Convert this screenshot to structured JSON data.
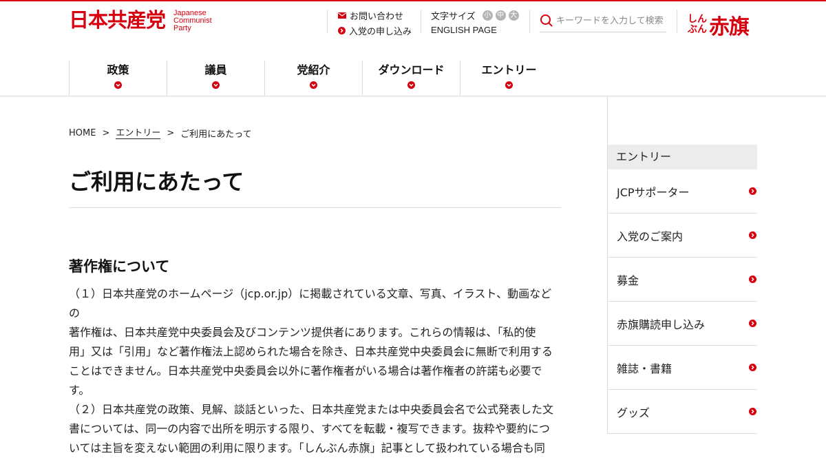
{
  "header": {
    "logo_jp": "日本共産党",
    "logo_en_lines": [
      "Japanese",
      "Communist",
      "Party"
    ],
    "contact_label": "お問い合わせ",
    "join_label": "入党の申し込み",
    "fontsize_label": "文字サイズ",
    "fontsize_small": "小",
    "fontsize_medium": "中",
    "fontsize_large": "大",
    "english_label": "ENGLISH PAGE",
    "search_placeholder": "キーワードを入力して検索",
    "akahata_small_1": "しん",
    "akahata_small_2": "ぶん",
    "akahata_big": "赤旗"
  },
  "nav": {
    "items": [
      {
        "label": "政策"
      },
      {
        "label": "議員"
      },
      {
        "label": "党紹介"
      },
      {
        "label": "ダウンロード"
      },
      {
        "label": "エントリー"
      }
    ]
  },
  "breadcrumb": {
    "home": "HOME",
    "sep": ">",
    "entry": "エントリー",
    "current": "ご利用にあたって"
  },
  "main": {
    "title": "ご利用にあたって",
    "section_title": "著作権について",
    "lines": [
      "（１）日本共産党のホームページ（jcp.or.jp）に掲載されている文章、写真、イラスト、動画などの",
      "著作権は、日本共産党中央委員会及びコンテンツ提供者にあります。これらの情報は、「私的使",
      "用」又は「引用」など著作権法上認められた場合を除き、日本共産党中央委員会に無断で利用する",
      "ことはできません。日本共産党中央委員会以外に著作権者がいる場合は著作権者の許諾も必要で",
      "す。",
      "（２）日本共産党の政策、見解、談話といった、日本共産党または中央委員会名で公式発表した文",
      "書については、同一の内容で出所を明示する限り、すべてを転載・複写できます。抜粋や要約につ",
      "いては主旨を変えない範囲の利用に限ります。「しんぶん赤旗」記事として扱われている場合も同"
    ]
  },
  "sidebar": {
    "heading": "エントリー",
    "items": [
      {
        "label": "JCPサポーター"
      },
      {
        "label": "入党のご案内"
      },
      {
        "label": "募金"
      },
      {
        "label": "赤旗購読申し込み"
      },
      {
        "label": "雑誌・書籍"
      },
      {
        "label": "グッズ"
      }
    ]
  },
  "colors": {
    "brand_red": "#d7000f",
    "divider": "#dcdcdc",
    "sidebar_head_bg": "#ececec"
  },
  "icons": [
    "mail-icon",
    "arrow-circle-icon",
    "search-icon",
    "chevron-down-icon"
  ]
}
